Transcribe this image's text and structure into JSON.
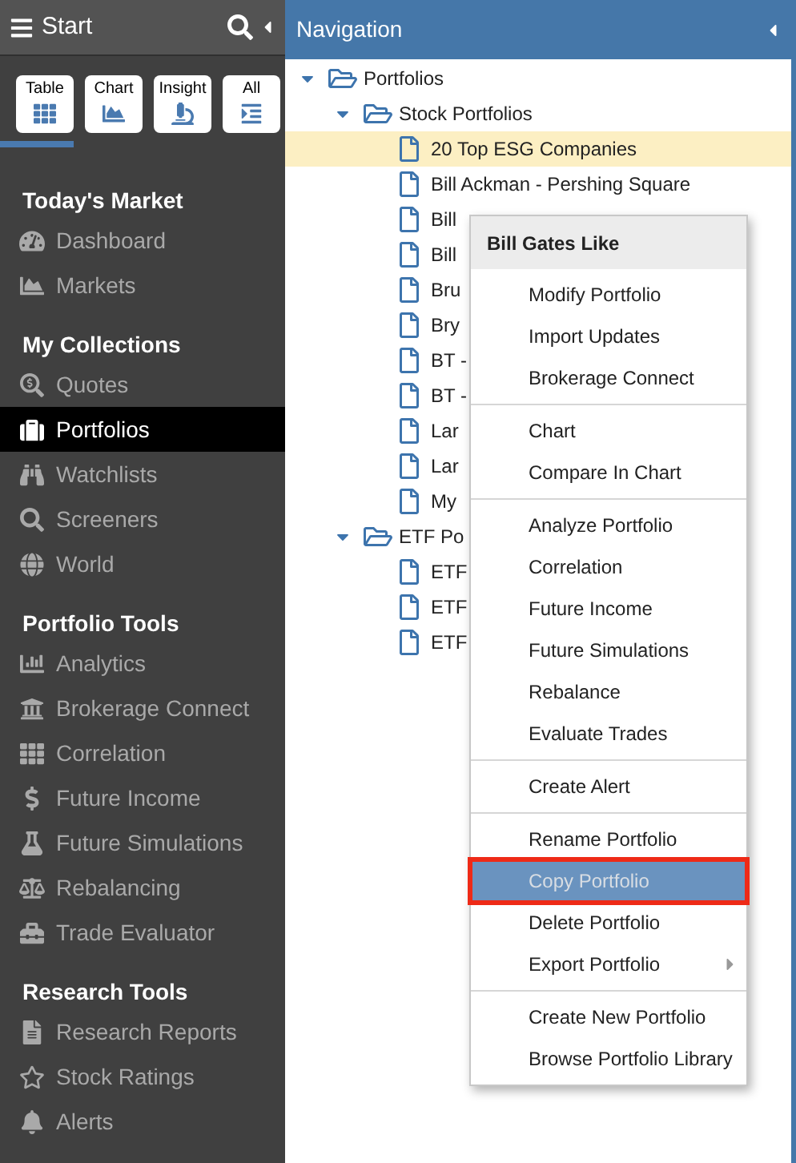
{
  "sidebar": {
    "title": "Start",
    "tabs": [
      {
        "label": "Table",
        "selected": true
      },
      {
        "label": "Chart",
        "selected": false
      },
      {
        "label": "Insight",
        "selected": false
      },
      {
        "label": "All",
        "selected": false
      }
    ],
    "sections": [
      {
        "title": "Today's Market",
        "items": [
          {
            "label": "Dashboard",
            "selected": false
          },
          {
            "label": "Markets",
            "selected": false
          }
        ]
      },
      {
        "title": "My Collections",
        "items": [
          {
            "label": "Quotes",
            "selected": false
          },
          {
            "label": "Portfolios",
            "selected": true
          },
          {
            "label": "Watchlists",
            "selected": false
          },
          {
            "label": "Screeners",
            "selected": false
          },
          {
            "label": "World",
            "selected": false
          }
        ]
      },
      {
        "title": "Portfolio Tools",
        "items": [
          {
            "label": "Analytics",
            "selected": false
          },
          {
            "label": "Brokerage Connect",
            "selected": false
          },
          {
            "label": "Correlation",
            "selected": false
          },
          {
            "label": "Future Income",
            "selected": false
          },
          {
            "label": "Future Simulations",
            "selected": false
          },
          {
            "label": "Rebalancing",
            "selected": false
          },
          {
            "label": "Trade Evaluator",
            "selected": false
          }
        ]
      },
      {
        "title": "Research Tools",
        "items": [
          {
            "label": "Research Reports",
            "selected": false
          },
          {
            "label": "Stock Ratings",
            "selected": false
          },
          {
            "label": "Alerts",
            "selected": false
          }
        ]
      }
    ]
  },
  "navigation": {
    "title": "Navigation",
    "tree": [
      {
        "label": "Portfolios",
        "kind": "folder",
        "expanded": true,
        "selected": false,
        "children": [
          {
            "label": "Stock Portfolios",
            "kind": "folder",
            "expanded": true,
            "selected": false,
            "children": [
              {
                "label": "20 Top ESG Companies",
                "kind": "file",
                "selected": true
              },
              {
                "label": "Bill Ackman - Pershing Square",
                "kind": "file",
                "selected": false
              },
              {
                "label": "Bill",
                "kind": "file",
                "selected": false
              },
              {
                "label": "Bill",
                "kind": "file",
                "selected": false
              },
              {
                "label": "Bru",
                "kind": "file",
                "selected": false
              },
              {
                "label": "Bry",
                "kind": "file",
                "selected": false
              },
              {
                "label": "BT -",
                "kind": "file",
                "selected": false
              },
              {
                "label": "BT -",
                "kind": "file",
                "selected": false
              },
              {
                "label": "Lar",
                "kind": "file",
                "selected": false
              },
              {
                "label": "Lar",
                "kind": "file",
                "selected": false
              },
              {
                "label": "My",
                "kind": "file",
                "selected": false
              }
            ]
          },
          {
            "label": "ETF Po",
            "kind": "folder",
            "expanded": true,
            "selected": false,
            "children": [
              {
                "label": "ETF",
                "kind": "file",
                "selected": false
              },
              {
                "label": "ETF",
                "kind": "file",
                "selected": false
              },
              {
                "label": "ETF",
                "kind": "file",
                "selected": false
              }
            ]
          }
        ]
      }
    ]
  },
  "context_menu": {
    "title": "Bill Gates Like",
    "groups": [
      [
        {
          "label": "Modify Portfolio",
          "selected": false,
          "highlighted": false,
          "has_submenu": false
        },
        {
          "label": "Import Updates",
          "selected": false,
          "highlighted": false,
          "has_submenu": false
        },
        {
          "label": "Brokerage Connect",
          "selected": false,
          "highlighted": false,
          "has_submenu": false
        }
      ],
      [
        {
          "label": "Chart",
          "selected": false,
          "highlighted": false,
          "has_submenu": false
        },
        {
          "label": "Compare In Chart",
          "selected": false,
          "highlighted": false,
          "has_submenu": false
        }
      ],
      [
        {
          "label": "Analyze Portfolio",
          "selected": false,
          "highlighted": false,
          "has_submenu": false
        },
        {
          "label": "Correlation",
          "selected": false,
          "highlighted": false,
          "has_submenu": false
        },
        {
          "label": "Future Income",
          "selected": false,
          "highlighted": false,
          "has_submenu": false
        },
        {
          "label": "Future Simulations",
          "selected": false,
          "highlighted": false,
          "has_submenu": false
        },
        {
          "label": "Rebalance",
          "selected": false,
          "highlighted": false,
          "has_submenu": false
        },
        {
          "label": "Evaluate Trades",
          "selected": false,
          "highlighted": false,
          "has_submenu": false
        }
      ],
      [
        {
          "label": "Create Alert",
          "selected": false,
          "highlighted": false,
          "has_submenu": false
        }
      ],
      [
        {
          "label": "Rename Portfolio",
          "selected": false,
          "highlighted": false,
          "has_submenu": false
        },
        {
          "label": "Copy Portfolio",
          "selected": true,
          "highlighted": true,
          "has_submenu": false
        },
        {
          "label": "Delete Portfolio",
          "selected": false,
          "highlighted": false,
          "has_submenu": false
        },
        {
          "label": "Export Portfolio",
          "selected": false,
          "highlighted": false,
          "has_submenu": true
        }
      ],
      [
        {
          "label": "Create New Portfolio",
          "selected": false,
          "highlighted": false,
          "has_submenu": false
        },
        {
          "label": "Browse Portfolio Library",
          "selected": false,
          "highlighted": false,
          "has_submenu": false
        }
      ]
    ]
  }
}
